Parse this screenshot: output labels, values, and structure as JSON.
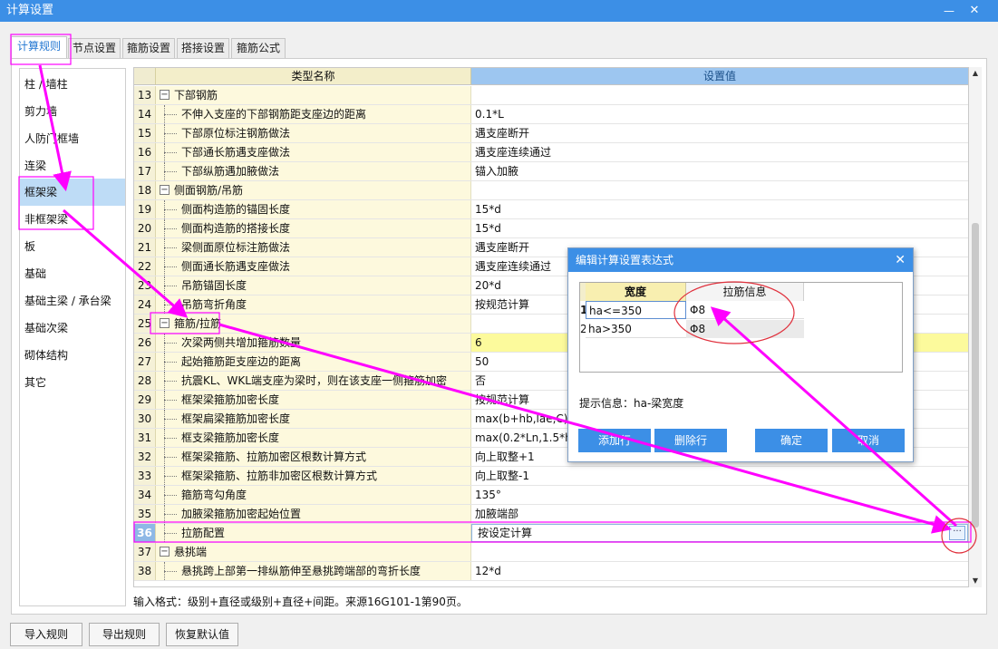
{
  "window": {
    "title": "计算设置",
    "minimize": "—",
    "close": "✕"
  },
  "tabs": [
    "计算规则",
    "节点设置",
    "箍筋设置",
    "搭接设置",
    "箍筋公式"
  ],
  "sidebar": [
    "柱 / 墙柱",
    "剪力墙",
    "人防门框墙",
    "连梁",
    "框架梁",
    "非框架梁",
    "板",
    "基础",
    "基础主梁 / 承台梁",
    "基础次梁",
    "砌体结构",
    "其它"
  ],
  "grid": {
    "headers": {
      "name": "类型名称",
      "value": "设置值"
    },
    "rows": [
      {
        "num": "13",
        "name": "下部钢筋",
        "value": ""
      },
      {
        "num": "14",
        "name": "不伸入支座的下部钢筋距支座边的距离",
        "value": "0.1*L"
      },
      {
        "num": "15",
        "name": "下部原位标注钢筋做法",
        "value": "遇支座断开"
      },
      {
        "num": "16",
        "name": "下部通长筋遇支座做法",
        "value": "遇支座连续通过"
      },
      {
        "num": "17",
        "name": "下部纵筋遇加腋做法",
        "value": "锚入加腋"
      },
      {
        "num": "18",
        "name": "侧面钢筋/吊筋",
        "value": ""
      },
      {
        "num": "19",
        "name": "侧面构造筋的锚固长度",
        "value": "15*d"
      },
      {
        "num": "20",
        "name": "侧面构造筋的搭接长度",
        "value": "15*d"
      },
      {
        "num": "21",
        "name": "梁侧面原位标注筋做法",
        "value": "遇支座断开"
      },
      {
        "num": "22",
        "name": "侧面通长筋遇支座做法",
        "value": "遇支座连续通过"
      },
      {
        "num": "23",
        "name": "吊筋锚固长度",
        "value": "20*d"
      },
      {
        "num": "24",
        "name": "吊筋弯折角度",
        "value": "按规范计算"
      },
      {
        "num": "25",
        "name": "箍筋/拉筋",
        "value": ""
      },
      {
        "num": "26",
        "name": "次梁两侧共增加箍筋数量",
        "value": "6"
      },
      {
        "num": "27",
        "name": "起始箍筋距支座边的距离",
        "value": "50"
      },
      {
        "num": "28",
        "name": "抗震KL、WKL端支座为梁时，则在该支座一侧箍筋加密",
        "value": "否"
      },
      {
        "num": "29",
        "name": "框架梁箍筋加密长度",
        "value": "按规范计算"
      },
      {
        "num": "30",
        "name": "框架扁梁箍筋加密长度",
        "value": "max(b+hb,lae,C)"
      },
      {
        "num": "31",
        "name": "框支梁箍筋加密长度",
        "value": "max(0.2*Ln,1.5*hb"
      },
      {
        "num": "32",
        "name": "框架梁箍筋、拉筋加密区根数计算方式",
        "value": "向上取整+1"
      },
      {
        "num": "33",
        "name": "框架梁箍筋、拉筋非加密区根数计算方式",
        "value": "向上取整-1"
      },
      {
        "num": "34",
        "name": "箍筋弯勾角度",
        "value": "135°"
      },
      {
        "num": "35",
        "name": "加腋梁箍筋加密起始位置",
        "value": "加腋端部"
      },
      {
        "num": "36",
        "name": "拉筋配置",
        "value": "按设定计算"
      },
      {
        "num": "37",
        "name": "悬挑端",
        "value": ""
      },
      {
        "num": "38",
        "name": "悬挑跨上部第一排纵筋伸至悬挑跨端部的弯折长度",
        "value": "12*d"
      }
    ],
    "ellipsis": "···"
  },
  "hint": "输入格式：级别+直径或级别+直径+间距。来源16G101-1第90页。",
  "bottom_buttons": [
    "导入规则",
    "导出规则",
    "恢复默认值"
  ],
  "dialog": {
    "title": "编辑计算设置表达式",
    "close": "✕",
    "headers": [
      "宽度",
      "拉筋信息"
    ],
    "rows": [
      {
        "idx": "1",
        "width": "ha<=350",
        "info": "Φ8"
      },
      {
        "idx": "2",
        "width": "ha>350",
        "info": "Φ8"
      }
    ],
    "info": "提示信息：ha-梁宽度",
    "buttons": [
      "添加行",
      "删除行",
      "确定",
      "取消"
    ]
  },
  "colors": {
    "accent": "#3c8fe6",
    "annotation": "#ff00ff",
    "annotation_circle": "#e0303c"
  }
}
